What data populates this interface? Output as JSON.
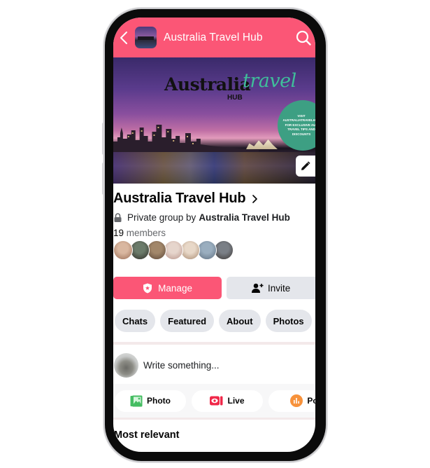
{
  "header": {
    "title": "Australia Travel Hub",
    "back_icon": "chevron-left-icon",
    "search_icon": "search-icon"
  },
  "cover": {
    "title_main": "Australia",
    "title_script": "travel",
    "title_sub": "HUB",
    "promo_text": "VISIT AUSTRALIATRAVELHUB FOR EXCLUSIVE AUS TRAVEL TIPS AND DISCOUNTS",
    "edit_icon": "pencil-icon"
  },
  "group": {
    "name": "Australia Travel Hub",
    "privacy_prefix": "Private group by",
    "owner": "Australia Travel Hub",
    "member_count": "19",
    "members_label": "members",
    "avatars": [
      {
        "colors": [
          "#d9b7a0",
          "#9a6d55"
        ]
      },
      {
        "colors": [
          "#6b7b6a",
          "#2d2a25"
        ]
      },
      {
        "colors": [
          "#a2876a",
          "#5a4536"
        ]
      },
      {
        "colors": [
          "#e6d5cc",
          "#b9948a"
        ]
      },
      {
        "colors": [
          "#e8d8c8",
          "#a88a70"
        ]
      },
      {
        "colors": [
          "#9aaebf",
          "#5e6f80"
        ]
      },
      {
        "colors": [
          "#7a7f86",
          "#3b3633"
        ]
      }
    ]
  },
  "actions": {
    "manage_label": "Manage",
    "invite_label": "Invite"
  },
  "tabs": [
    {
      "label": "Chats"
    },
    {
      "label": "Featured"
    },
    {
      "label": "About"
    },
    {
      "label": "Photos"
    }
  ],
  "composer": {
    "placeholder": "Write something..."
  },
  "quick_actions": [
    {
      "label": "Photo",
      "icon": "photo-icon",
      "color": "#45bd62"
    },
    {
      "label": "Live",
      "icon": "live-video-icon",
      "color": "#f02849"
    },
    {
      "label": "Po",
      "icon": "poll-icon",
      "color": "#f7923b"
    }
  ],
  "feed": {
    "sort_label": "Most relevant"
  },
  "colors": {
    "accent": "#fb5676",
    "chip_bg": "#e4e6eb"
  }
}
